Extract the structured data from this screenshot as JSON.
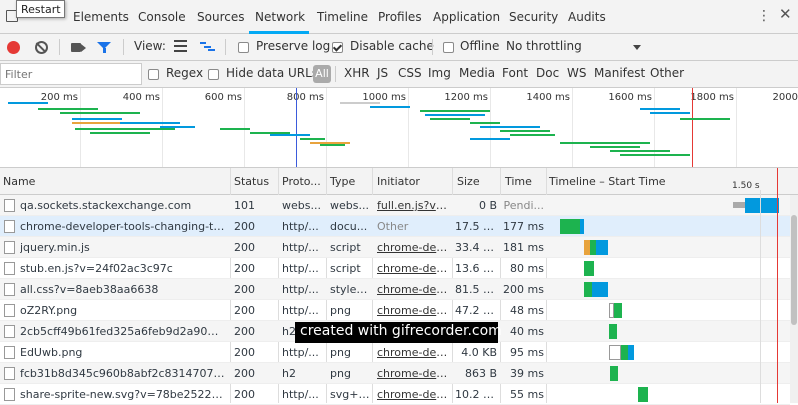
{
  "tooltip": "Restart",
  "tabs": [
    "Elements",
    "Console",
    "Sources",
    "Network",
    "Timeline",
    "Profiles",
    "Application",
    "Security",
    "Audits"
  ],
  "active_tab": "Network",
  "toolbar": {
    "view_label": "View:",
    "preserve_log": "Preserve log",
    "disable_cache": "Disable cache",
    "offline": "Offline",
    "throttling": "No throttling"
  },
  "filterbar": {
    "placeholder": "Filter",
    "regex": "Regex",
    "hide_data_urls": "Hide data URLs",
    "types": [
      "All",
      "XHR",
      "JS",
      "CSS",
      "Img",
      "Media",
      "Font",
      "Doc",
      "WS",
      "Manifest",
      "Other"
    ]
  },
  "overview": {
    "ticks": [
      "200 ms",
      "400 ms",
      "600 ms",
      "800 ms",
      "1000 ms",
      "1200 ms",
      "1400 ms",
      "1600 ms",
      "1800 ms",
      "2000"
    ]
  },
  "table": {
    "columns": [
      "Name",
      "Status",
      "Proto...",
      "Type",
      "Initiator",
      "Size",
      "Time",
      "Timeline – Start Time"
    ],
    "timeline_marker": "1.50 s",
    "rows": [
      {
        "name": "qa.sockets.stackexchange.com",
        "status": "101",
        "proto": "webs...",
        "type": "webs...",
        "initiator": "full.en.js?v=e...",
        "size": "0 B",
        "time": "Pendi..."
      },
      {
        "name": "chrome-developer-tools-changing-the-s...",
        "status": "200",
        "proto": "http/...",
        "type": "docu...",
        "initiator": "Other",
        "size": "17.5 KB",
        "time": "177 ms"
      },
      {
        "name": "jquery.min.js",
        "status": "200",
        "proto": "http/...",
        "type": "script",
        "initiator": "chrome-dev...",
        "size": "33.4 KB",
        "time": "181 ms"
      },
      {
        "name": "stub.en.js?v=24f02ac3c97c",
        "status": "200",
        "proto": "http/...",
        "type": "script",
        "initiator": "chrome-dev...",
        "size": "13.6 KB",
        "time": "80 ms"
      },
      {
        "name": "all.css?v=8aeb38aa6638",
        "status": "200",
        "proto": "http/...",
        "type": "styles...",
        "initiator": "chrome-dev...",
        "size": "81.5 KB",
        "time": "200 ms"
      },
      {
        "name": "oZ2RY.png",
        "status": "200",
        "proto": "http/...",
        "type": "png",
        "initiator": "chrome-dev...",
        "size": "47.2 KB",
        "time": "48 ms"
      },
      {
        "name": "2cb5cff49b61fed325a6feb9d2a905aa?s=...",
        "status": "200",
        "proto": "h2",
        "type": "",
        "initiator": "",
        "size": "",
        "time": "40 ms"
      },
      {
        "name": "EdUwb.png",
        "status": "200",
        "proto": "http/...",
        "type": "png",
        "initiator": "chrome-dev...",
        "size": "4.0 KB",
        "time": "95 ms"
      },
      {
        "name": "fcb31b8d345c960b8abf2c831470773b?s...",
        "status": "200",
        "proto": "h2",
        "type": "png",
        "initiator": "chrome-dev...",
        "size": "863 B",
        "time": "39 ms"
      },
      {
        "name": "share-sprite-new.svg?v=78be252218f3",
        "status": "200",
        "proto": "http/...",
        "type": "svg+x...",
        "initiator": "chrome-dev...",
        "size": "10.2 KB",
        "time": "55 ms"
      }
    ]
  },
  "watermark": "created with gifrecorder.com",
  "colors": {
    "accent": "#03a9f4",
    "record": "#e53935",
    "green": "#1db34f",
    "blue": "#0299de",
    "orange": "#e8a33d"
  }
}
